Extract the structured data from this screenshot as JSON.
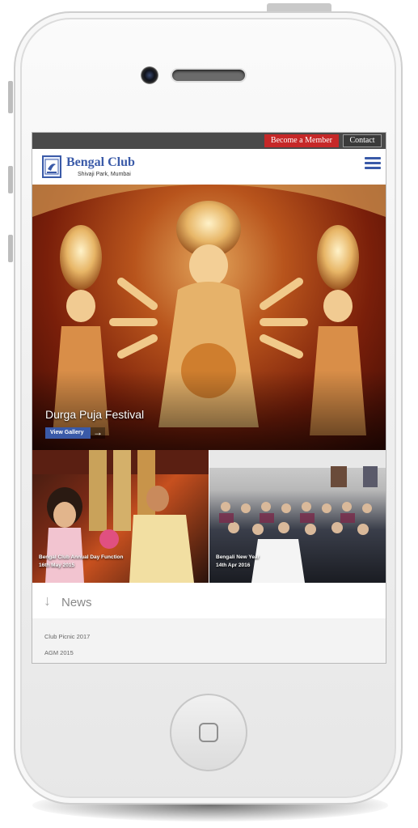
{
  "topbar": {
    "member_label": "Become a Member",
    "contact_label": "Contact"
  },
  "header": {
    "title": "Bengal Club",
    "subtitle": "Shivaji Park, Mumbai"
  },
  "hero": {
    "title": "Durga Puja Festival",
    "button_label": "View Gallery"
  },
  "thumbnails": [
    {
      "caption": "Bengal Club Annual Day Function",
      "date": "16th May 2015"
    },
    {
      "caption": "Bengali New Year",
      "date": "14th Apr 2016"
    }
  ],
  "news": {
    "heading": "News",
    "items": [
      "Club Picnic 2017",
      "AGM 2015"
    ]
  },
  "colors": {
    "brand": "#3a5aa8",
    "member_button": "#c62828",
    "topbar": "#4a4a4a"
  }
}
